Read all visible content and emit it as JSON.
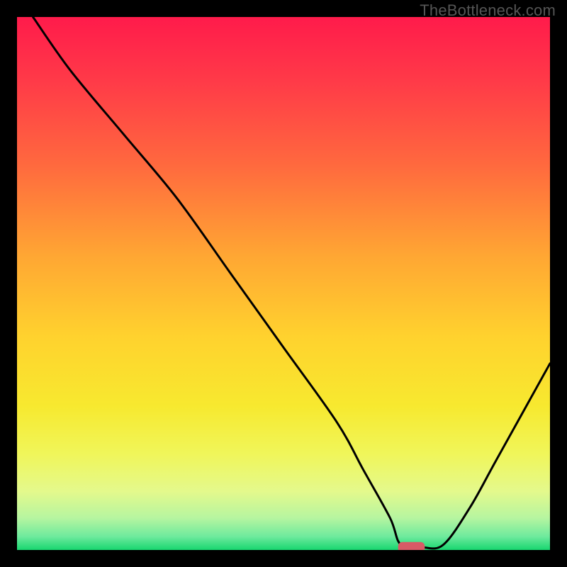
{
  "watermark": "TheBottleneck.com",
  "chart_data": {
    "type": "line",
    "title": "",
    "xlabel": "",
    "ylabel": "",
    "xlim": [
      0,
      100
    ],
    "ylim": [
      0,
      100
    ],
    "grid": false,
    "legend": false,
    "series": [
      {
        "name": "bottleneck-curve",
        "x": [
          3,
          10,
          20,
          30,
          40,
          50,
          60,
          65,
          70,
          72,
          76,
          80,
          85,
          90,
          100
        ],
        "y": [
          100,
          90,
          78,
          66,
          52,
          38,
          24,
          15,
          6,
          1,
          0.5,
          1,
          8,
          17,
          35
        ]
      }
    ],
    "marker": {
      "name": "optimal-point",
      "x": 74,
      "y": 0.5,
      "color": "#d85a66",
      "width": 5,
      "height": 2
    },
    "gradient_stops": [
      {
        "offset": 0.0,
        "color": "#ff1b4b"
      },
      {
        "offset": 0.12,
        "color": "#ff3a48"
      },
      {
        "offset": 0.28,
        "color": "#ff6a3e"
      },
      {
        "offset": 0.45,
        "color": "#ffa733"
      },
      {
        "offset": 0.6,
        "color": "#ffd22e"
      },
      {
        "offset": 0.73,
        "color": "#f7e92f"
      },
      {
        "offset": 0.82,
        "color": "#f0f65a"
      },
      {
        "offset": 0.89,
        "color": "#e4f98c"
      },
      {
        "offset": 0.94,
        "color": "#b6f5a0"
      },
      {
        "offset": 0.975,
        "color": "#6dea9d"
      },
      {
        "offset": 1.0,
        "color": "#18d66f"
      }
    ]
  }
}
